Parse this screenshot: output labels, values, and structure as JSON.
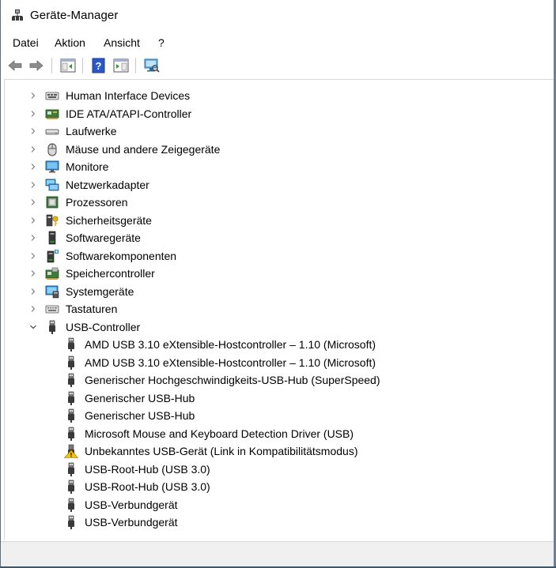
{
  "window": {
    "title": "Geräte-Manager"
  },
  "menu": {
    "items": [
      {
        "label": "Datei"
      },
      {
        "label": "Aktion"
      },
      {
        "label": "Ansicht"
      },
      {
        "label": "?"
      }
    ]
  },
  "toolbar": {
    "buttons": [
      {
        "icon": "back-arrow-icon"
      },
      {
        "icon": "forward-arrow-icon"
      },
      {
        "icon": "show-hide-console-tree-icon"
      },
      {
        "icon": "help-icon"
      },
      {
        "icon": "properties-pane-icon"
      },
      {
        "icon": "scan-hardware-icon"
      }
    ]
  },
  "tree": {
    "categories": [
      {
        "label": "Human Interface Devices",
        "icon": "hid-icon",
        "expanded": false
      },
      {
        "label": "IDE ATA/ATAPI-Controller",
        "icon": "ide-controller-icon",
        "expanded": false
      },
      {
        "label": "Laufwerke",
        "icon": "disk-drive-icon",
        "expanded": false
      },
      {
        "label": "Mäuse und andere Zeigegeräte",
        "icon": "mouse-icon",
        "expanded": false
      },
      {
        "label": "Monitore",
        "icon": "monitor-icon",
        "expanded": false
      },
      {
        "label": "Netzwerkadapter",
        "icon": "network-adapter-icon",
        "expanded": false
      },
      {
        "label": "Prozessoren",
        "icon": "processor-icon",
        "expanded": false
      },
      {
        "label": "Sicherheitsgeräte",
        "icon": "security-device-icon",
        "expanded": false
      },
      {
        "label": "Softwaregeräte",
        "icon": "software-device-icon",
        "expanded": false
      },
      {
        "label": "Softwarekomponenten",
        "icon": "software-component-icon",
        "expanded": false
      },
      {
        "label": "Speichercontroller",
        "icon": "storage-controller-icon",
        "expanded": false
      },
      {
        "label": "Systemgeräte",
        "icon": "system-device-icon",
        "expanded": false
      },
      {
        "label": "Tastaturen",
        "icon": "keyboard-icon",
        "expanded": false
      },
      {
        "label": "USB-Controller",
        "icon": "usb-icon",
        "expanded": true
      }
    ],
    "usb_children": [
      {
        "label": "AMD USB 3.10 eXtensible-Hostcontroller – 1.10 (Microsoft)",
        "icon": "usb-plug-icon"
      },
      {
        "label": "AMD USB 3.10 eXtensible-Hostcontroller – 1.10 (Microsoft)",
        "icon": "usb-plug-icon"
      },
      {
        "label": "Generischer Hochgeschwindigkeits-USB-Hub (SuperSpeed)",
        "icon": "usb-plug-icon"
      },
      {
        "label": "Generischer USB-Hub",
        "icon": "usb-plug-icon"
      },
      {
        "label": "Generischer USB-Hub",
        "icon": "usb-plug-icon"
      },
      {
        "label": "Microsoft Mouse and Keyboard Detection Driver (USB)",
        "icon": "usb-plug-icon"
      },
      {
        "label": "Unbekanntes USB-Gerät (Link in Kompatibilitätsmodus)",
        "icon": "warning-icon"
      },
      {
        "label": "USB-Root-Hub (USB 3.0)",
        "icon": "usb-plug-icon"
      },
      {
        "label": "USB-Root-Hub (USB 3.0)",
        "icon": "usb-plug-icon"
      },
      {
        "label": "USB-Verbundgerät",
        "icon": "usb-plug-icon"
      },
      {
        "label": "USB-Verbundgerät",
        "icon": "usb-plug-icon"
      }
    ]
  },
  "colors": {
    "accent_blue": "#1e73c8",
    "help_icon": "#2b58c8",
    "warning_yellow": "#f5c400",
    "statusbar": "#f0f0f0"
  }
}
